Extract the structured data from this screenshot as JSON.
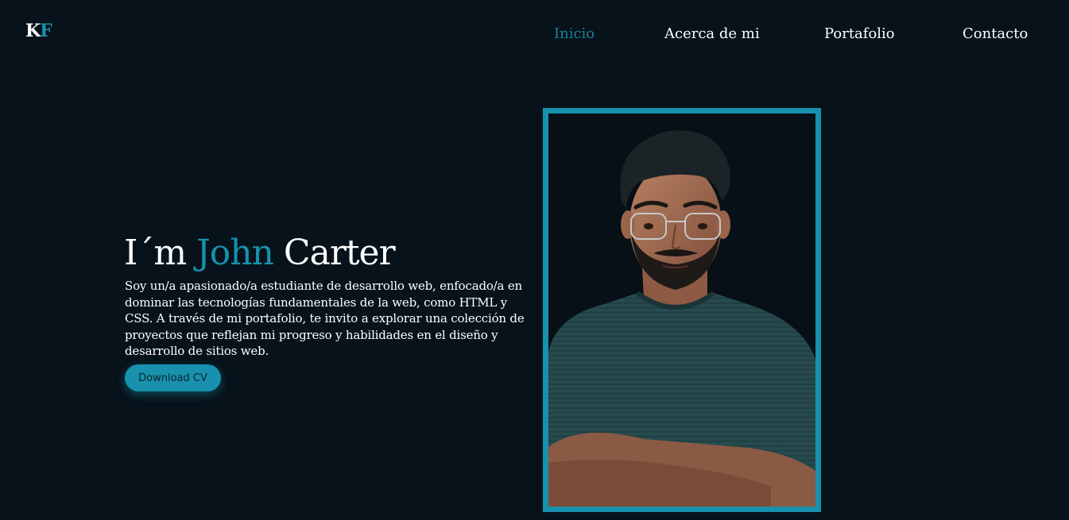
{
  "logo": {
    "k": "K",
    "f": "F"
  },
  "nav": {
    "items": [
      {
        "label": "Inicio",
        "active": true
      },
      {
        "label": "Acerca de mi",
        "active": false
      },
      {
        "label": "Portafolio",
        "active": false
      },
      {
        "label": "Contacto",
        "active": false
      }
    ]
  },
  "hero": {
    "title_prefix": "I´m",
    "title_name": "John",
    "title_last": "Carter",
    "description": "Soy un/a apasionado/a estudiante de desarrollo web, enfocado/a en dominar las tecnologías fundamentales de la web, como HTML y CSS. A través de mi portafolio, te invito a explorar una colección de proyectos que reflejan mi progreso y habilidades en el diseño y desarrollo de sitios web.",
    "cv_button": "Download CV"
  },
  "colors": {
    "background": "#07121a",
    "accent": "#1791ad",
    "nav_active": "#1c7f9a",
    "text": "#ffffff"
  }
}
